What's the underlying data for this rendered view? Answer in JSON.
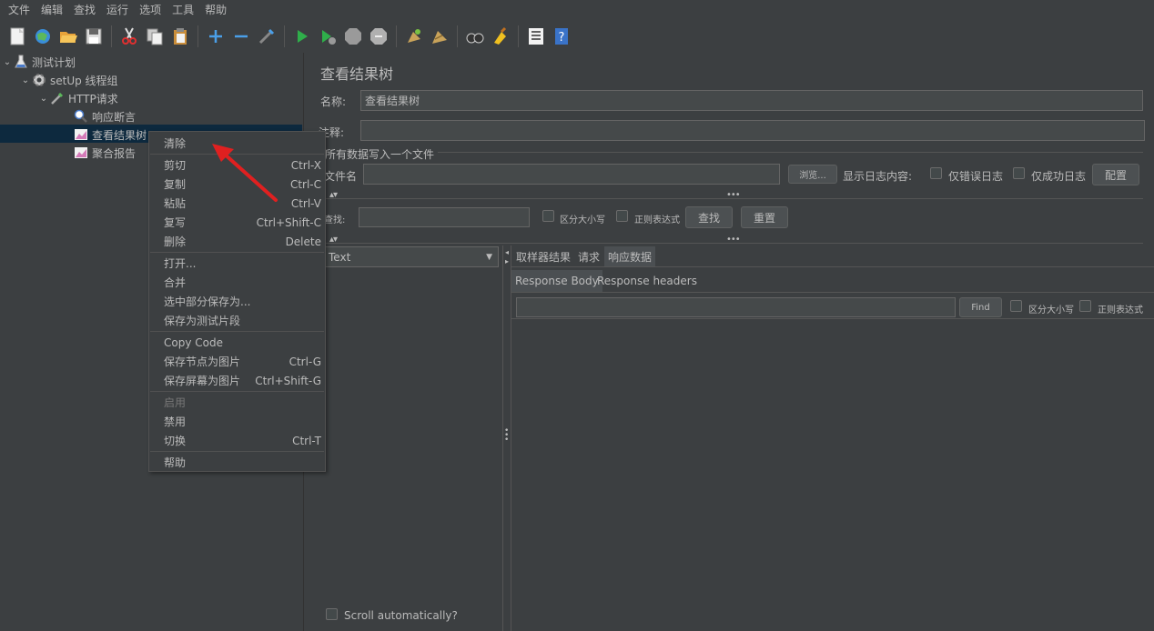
{
  "menu": [
    "文件",
    "编辑",
    "查找",
    "运行",
    "选项",
    "工具",
    "帮助"
  ],
  "toolbar_icons": [
    "new-icon",
    "templates-icon",
    "open-icon",
    "save-icon",
    "cut-icon",
    "copy-icon",
    "paste-icon",
    "expand-icon",
    "collapse-icon",
    "toggle-icon",
    "start-icon",
    "start-no-pause-icon",
    "stop-icon",
    "shutdown-icon",
    "clear-icon",
    "clear-all-icon",
    "search-icon",
    "reset-search-icon",
    "function-helper-icon",
    "help-icon"
  ],
  "tree": {
    "plan": "测试计划",
    "thread_group": "setUp 线程组",
    "http": "HTTP请求",
    "assert": "响应断言",
    "view_tree": "查看结果树",
    "agg_report": "聚合报告"
  },
  "context_menu": {
    "clear": "清除",
    "cut": "剪切",
    "cut_sc": "Ctrl-X",
    "copy": "复制",
    "copy_sc": "Ctrl-C",
    "paste": "粘贴",
    "paste_sc": "Ctrl-V",
    "dup": "复写",
    "dup_sc": "Ctrl+Shift-C",
    "delete": "删除",
    "delete_sc": "Delete",
    "open": "打开...",
    "merge": "合并",
    "save_sel": "选中部分保存为...",
    "save_frag": "保存为测试片段",
    "copy_code": "Copy Code",
    "save_node_img": "保存节点为图片",
    "save_node_img_sc": "Ctrl-G",
    "save_screen_img": "保存屏幕为图片",
    "save_screen_img_sc": "Ctrl+Shift-G",
    "enable": "启用",
    "disable": "禁用",
    "toggle": "切换",
    "toggle_sc": "Ctrl-T",
    "help": "帮助"
  },
  "panel": {
    "title": "查看结果树",
    "name_label": "名称:",
    "name_value": "查看结果树",
    "comment_label": "注释:",
    "comment_value": "",
    "file_section": "所有数据写入一个文件",
    "filename_label": "文件名",
    "filename_value": "",
    "browse": "浏览...",
    "log_label": "显示日志内容:",
    "errors_only": "仅错误日志",
    "success_only": "仅成功日志",
    "configure": "配置",
    "search_label": "查找:",
    "search_value": "",
    "case_sensitive": "区分大小写",
    "regex": "正则表达式",
    "search_btn": "查找",
    "reset_btn": "重置",
    "renderer": "Text",
    "tabs": [
      "取样器结果",
      "请求",
      "响应数据"
    ],
    "subtabs": [
      "Response Body",
      "Response headers"
    ],
    "find_btn": "Find",
    "find_case": "区分大小写",
    "find_regex": "正则表达式",
    "scroll_auto": "Scroll automatically?"
  },
  "colors": {
    "background": "#3c3f41",
    "selection": "#0d293e",
    "arrow": "#e02020"
  }
}
